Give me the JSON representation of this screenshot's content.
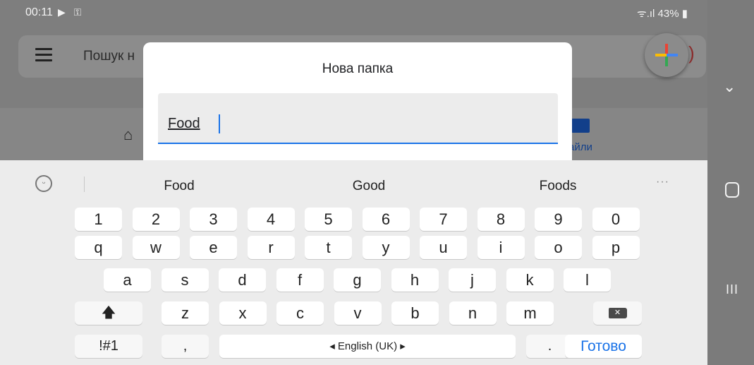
{
  "status_bar": {
    "time": "00:11",
    "left_icons": "▶ ⚿",
    "right_text": "ᯤ.ıl 43% ▮"
  },
  "app": {
    "search_placeholder": "Пошук н",
    "nav_files_label": "айли",
    "fab_colors": {
      "red": "#ea4335",
      "blue": "#4285f4",
      "green": "#34a853",
      "yellow": "#fbbc04"
    }
  },
  "dialog": {
    "title": "Нова папка",
    "input_value": "Food",
    "accent": "#1a73e8"
  },
  "keyboard": {
    "suggestions": [
      "Food",
      "Good",
      "Foods"
    ],
    "more_label": "···",
    "rows": [
      [
        "1",
        "2",
        "3",
        "4",
        "5",
        "6",
        "7",
        "8",
        "9",
        "0"
      ],
      [
        "q",
        "w",
        "e",
        "r",
        "t",
        "y",
        "u",
        "i",
        "o",
        "p"
      ],
      [
        "a",
        "s",
        "d",
        "f",
        "g",
        "h",
        "j",
        "k",
        "l"
      ],
      [
        "z",
        "x",
        "c",
        "v",
        "b",
        "n",
        "m"
      ]
    ],
    "shift_label": "🡅",
    "symbols_label": "!#1",
    "comma_label": ",",
    "space_label": "◂ English (UK) ▸",
    "period_label": ".",
    "done_label": "Готово",
    "backspace_label": "✕"
  },
  "system_nav": {
    "chevron": "⌄",
    "recent": "III"
  }
}
